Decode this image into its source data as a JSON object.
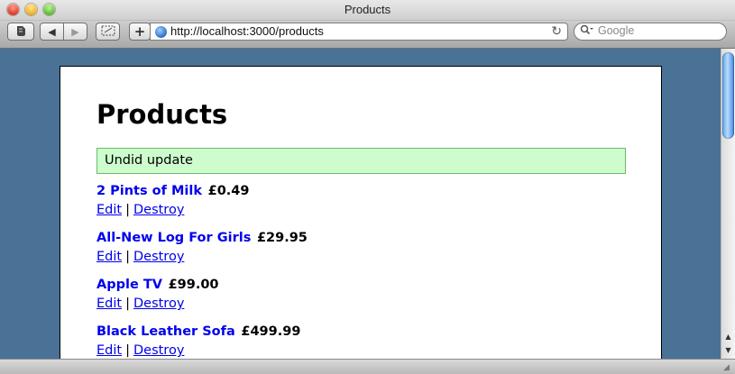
{
  "window": {
    "title": "Products"
  },
  "toolbar": {
    "add_label": "+",
    "url": "http://localhost:3000/products",
    "search_placeholder": "Google",
    "icons": [
      "evernote-icon",
      "back-icon",
      "forward-icon",
      "clip-icon",
      "add-bookmark-icon",
      "globe-icon",
      "reload-icon",
      "search-icon"
    ]
  },
  "page": {
    "title": "Products",
    "flash": "Undid update",
    "separator": "|",
    "products": [
      {
        "name": "2 Pints of Milk",
        "price": "£0.49",
        "edit": "Edit",
        "destroy": "Destroy"
      },
      {
        "name": "All-New Log For Girls",
        "price": "£29.95",
        "edit": "Edit",
        "destroy": "Destroy"
      },
      {
        "name": "Apple TV",
        "price": "£99.00",
        "edit": "Edit",
        "destroy": "Destroy"
      },
      {
        "name": "Black Leather Sofa",
        "price": "£499.99",
        "edit": "Edit",
        "destroy": "Destroy"
      }
    ]
  },
  "colors": {
    "desktop": "#4a7196",
    "link": "#0000ee",
    "flash_bg": "#cdfdcd",
    "flash_border": "#6dbb6d"
  }
}
